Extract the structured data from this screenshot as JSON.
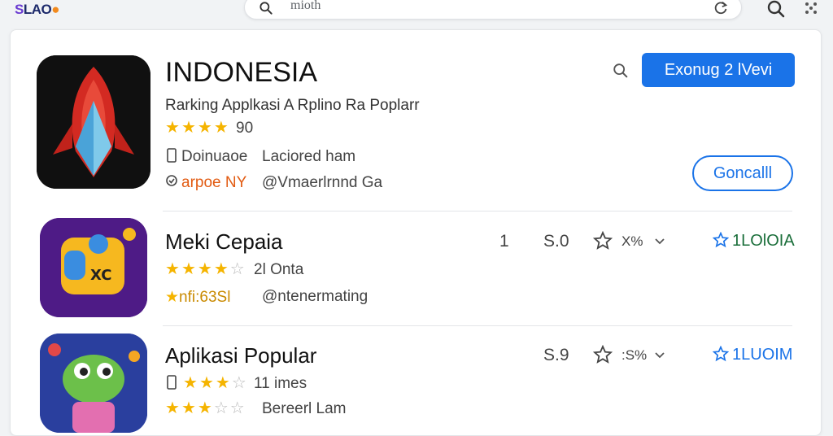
{
  "topbar": {
    "logo_s": "S",
    "logo_rest": "LAO",
    "logo_dot": "●",
    "search_value": "mioth"
  },
  "featured": {
    "title": "INDONESIA",
    "subtitle": "Rarking Applkasi A Rplino Ra Poplarr",
    "rating": "90",
    "meta1": "Doinuaoe",
    "meta2": "Laciored ham",
    "meta3": "arpoe NY",
    "meta4": "@Vmaerlrnnd Ga",
    "primary_button": "Exonug 2 lVevi",
    "secondary_button": "Goncalll"
  },
  "apps": [
    {
      "title": "Meki Cepaia",
      "rating_text": "2l Onta",
      "meta_left": "nfi:63Sl",
      "meta_right": "@ntenermating",
      "count": "1",
      "score": "S.0",
      "pct": "X%",
      "link": "1LOlOIA"
    },
    {
      "title": "Aplikasi Popular",
      "rating_text": "11 imes",
      "meta_left": "",
      "meta_right": "Bereerl Lam",
      "score": "S.9",
      "pct": ":S%",
      "link": "1LUOIM"
    }
  ],
  "colors": {
    "accent": "#1a73e8",
    "star": "#f5b400",
    "link_green": "#1a6e3a",
    "orange": "#e25b12"
  }
}
